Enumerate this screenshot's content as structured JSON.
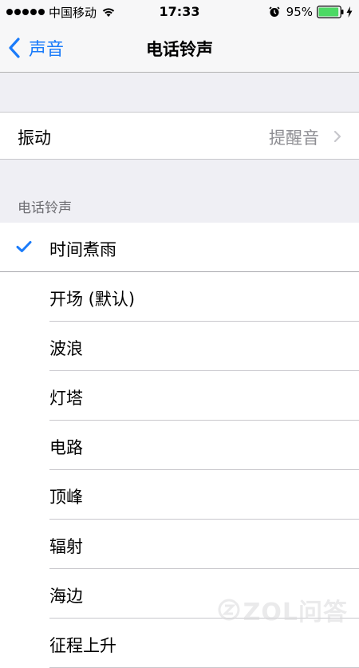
{
  "status_bar": {
    "carrier": "中国移动",
    "time": "17:33",
    "battery_percent": "95%",
    "battery_level": 0.95,
    "icons": [
      "signal-dots-icon",
      "wifi-icon",
      "alarm-icon",
      "battery-icon",
      "charging-icon"
    ]
  },
  "nav": {
    "back_label": "声音",
    "title": "电话铃声"
  },
  "vibration": {
    "label": "振动",
    "value": "提醒音"
  },
  "section": {
    "header": "电话铃声"
  },
  "ringtones": [
    {
      "label": "时间煮雨",
      "selected": true
    },
    {
      "label": "开场 (默认)",
      "selected": false
    },
    {
      "label": "波浪",
      "selected": false
    },
    {
      "label": "灯塔",
      "selected": false
    },
    {
      "label": "电路",
      "selected": false
    },
    {
      "label": "顶峰",
      "selected": false
    },
    {
      "label": "辐射",
      "selected": false
    },
    {
      "label": "海边",
      "selected": false
    },
    {
      "label": "征程上升",
      "selected": false
    }
  ],
  "watermark": {
    "text": "ZOL问答"
  },
  "colors": {
    "accent": "#1a7bfa",
    "battery": "#4cd964",
    "background": "#efeff4"
  }
}
